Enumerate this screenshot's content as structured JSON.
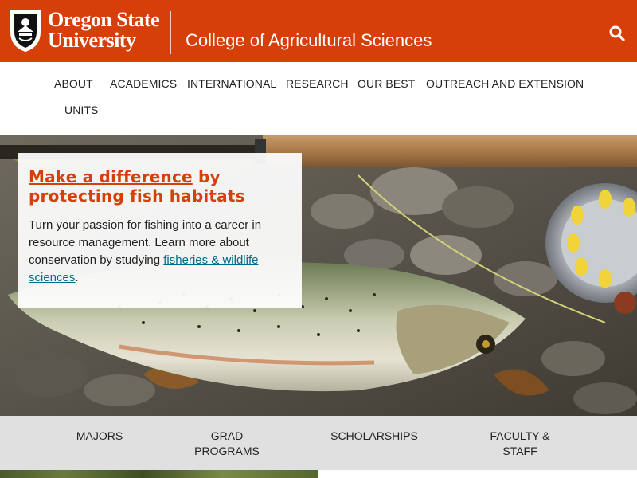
{
  "header": {
    "logo_line1": "Oregon State",
    "logo_line2": "University",
    "college_name": "College of Agricultural Sciences",
    "background_color": "#d73f09",
    "search_icon": "search-icon"
  },
  "nav": {
    "items": [
      {
        "label": "ABOUT"
      },
      {
        "label": "ACADEMICS"
      },
      {
        "label": "INTERNATIONAL"
      },
      {
        "label": "RESEARCH"
      },
      {
        "label": "OUR BEST"
      },
      {
        "label": "OUTREACH AND EXTENSION"
      },
      {
        "label": "UNITS"
      }
    ]
  },
  "hero": {
    "title_link": "Make a difference",
    "title_rest_1": " by",
    "title_rest_2": "protecting fish habitats",
    "body_text": "Turn your passion for fishing into a career in resource management. Learn more about conservation by studying ",
    "body_link": "fisheries & wildlife sciences",
    "body_end": ".",
    "accent_color": "#d73f09",
    "link_color": "#006a8e"
  },
  "quick_links": {
    "items": [
      {
        "line1": "MAJORS",
        "line2": ""
      },
      {
        "line1": "GRAD",
        "line2": "PROGRAMS"
      },
      {
        "line1": "SCHOLARSHIPS",
        "line2": ""
      },
      {
        "line1": "FACULTY &",
        "line2": "STAFF"
      }
    ],
    "background_color": "#e0e0e0"
  }
}
